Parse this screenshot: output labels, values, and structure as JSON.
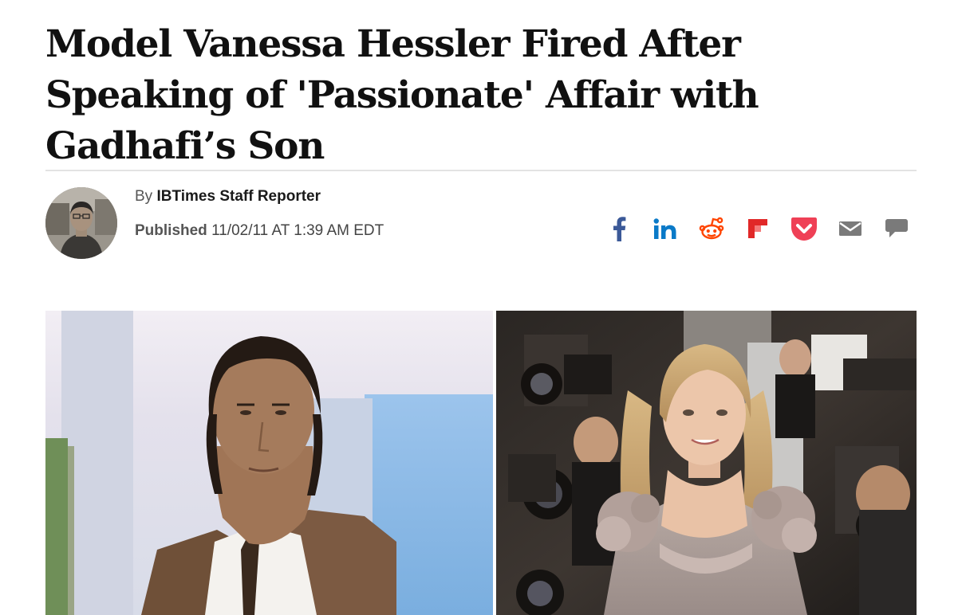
{
  "article": {
    "headline": "Model Vanessa Hessler Fired After Speaking of 'Passionate' Affair with Gadhafi’s Son",
    "byline_prefix": "By",
    "author": "IBTimes Staff Reporter",
    "published_label": "Published",
    "published_date": "11/02/11 AT 1:39 AM EDT"
  },
  "share": [
    {
      "icon": "facebook-icon",
      "color": "#3b5998"
    },
    {
      "icon": "linkedin-icon",
      "color": "#0a7ac8"
    },
    {
      "icon": "reddit-icon",
      "color": "#ff4500"
    },
    {
      "icon": "flipboard-icon",
      "color": "#e12828"
    },
    {
      "icon": "pocket-icon",
      "color": "#ef4056"
    },
    {
      "icon": "email-icon",
      "color": "#7a7a7a"
    },
    {
      "icon": "comment-icon",
      "color": "#7a7a7a"
    }
  ],
  "colors": {
    "headline": "#111111",
    "divider": "#e3e3e3"
  }
}
